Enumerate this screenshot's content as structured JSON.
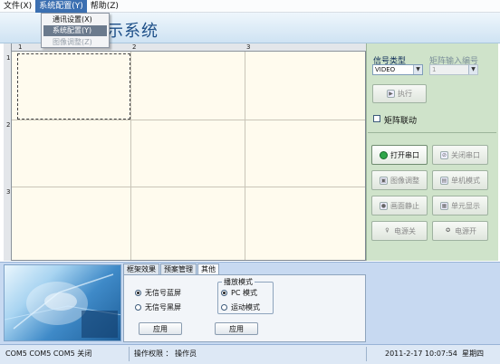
{
  "menu": {
    "file": "文件(X)",
    "config": "系统配置(Y)",
    "help": "帮助(Z)"
  },
  "dropdown": {
    "items": [
      {
        "label": "通讯设置(X)",
        "state": "normal"
      },
      {
        "label": "系统配置(Y)",
        "state": "selected"
      },
      {
        "label": "图像调整(Z)",
        "state": "disabled"
      }
    ]
  },
  "app": {
    "title_visible": "示系统"
  },
  "grid": {
    "col_headers": [
      "1",
      "2",
      "3"
    ],
    "row_headers": [
      "1",
      "2",
      "3"
    ]
  },
  "right_panel": {
    "signal_type_label": "信号类型",
    "matrix_label": "矩阵输入编号",
    "signal_value": "VIDEO",
    "matrix_value": "1",
    "execute_label": "执行",
    "matrix_link_label": "矩阵联动",
    "buttons": [
      {
        "label": "打开串口",
        "icon": "green-dot-icon",
        "enabled": true
      },
      {
        "label": "关闭串口",
        "icon": "disconnect-icon",
        "enabled": false
      },
      {
        "label": "图像调整",
        "icon": "image-adjust-icon",
        "enabled": false
      },
      {
        "label": "单机模式",
        "icon": "single-mode-icon",
        "enabled": false
      },
      {
        "label": "画面静止",
        "icon": "lock-icon",
        "enabled": false
      },
      {
        "label": "单元显示",
        "icon": "grid-icon",
        "enabled": false
      },
      {
        "label": "电源关",
        "icon": "power-off-icon",
        "enabled": false
      },
      {
        "label": "电源开",
        "icon": "power-on-icon",
        "enabled": false
      }
    ],
    "colors": {
      "panel_bg": "#cfe3ca",
      "accent_green": "#2fa64a"
    }
  },
  "tabs": {
    "items": [
      "框架效果",
      "预案管理",
      "其他"
    ],
    "active_index": 2
  },
  "other_tab": {
    "radio_left": [
      {
        "label": "无信号蓝屏",
        "checked": true
      },
      {
        "label": "无信号黑屏",
        "checked": false
      }
    ],
    "play_mode_title": "播放模式",
    "radio_right": [
      {
        "label": "PC 模式",
        "checked": true
      },
      {
        "label": "运动模式",
        "checked": false
      }
    ],
    "apply_left": "应用",
    "apply_right": "应用"
  },
  "status": {
    "ports": "COM5 COM5 COM5 关闭",
    "permission": "操作权限 ： 操作员",
    "datetime": "2011-2-17 10:07:54",
    "weekday": "星期四"
  }
}
